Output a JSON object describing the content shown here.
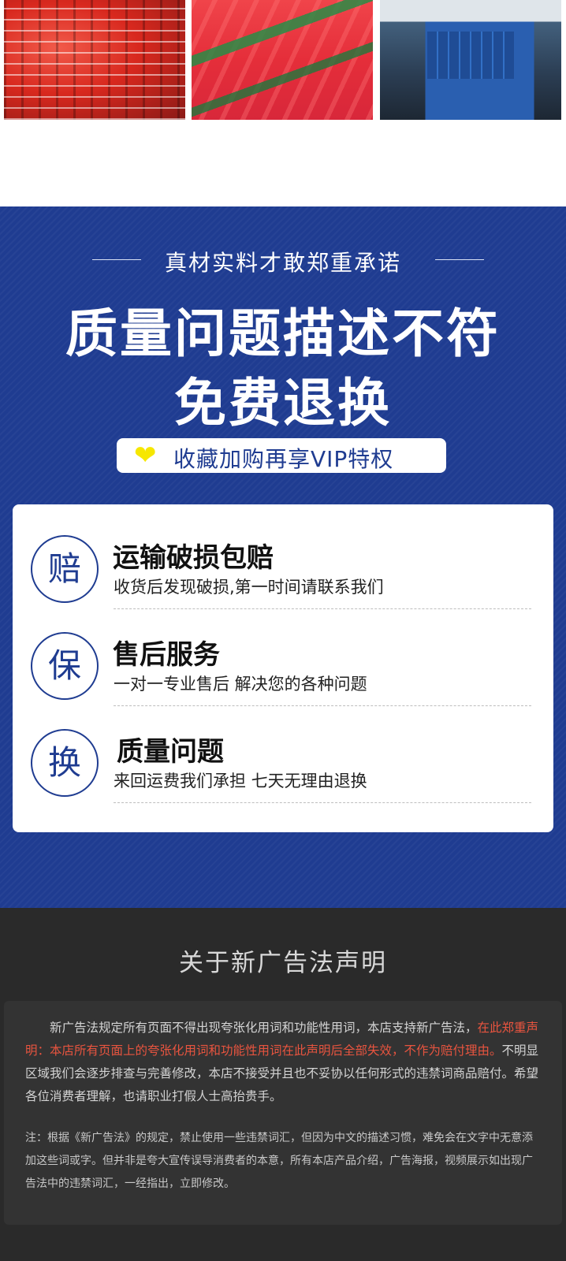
{
  "photos": [
    {
      "alt": "red lifebuoys stack"
    },
    {
      "alt": "red life jackets"
    },
    {
      "alt": "factory machinery"
    }
  ],
  "promise": {
    "subtitle": "真材实料才敢郑重承诺",
    "headline_line1": "质量问题描述不符",
    "headline_line2": "免费退换",
    "vip_icon": "heart-icon",
    "vip_text": "收藏加购再享VIP特权",
    "accent_color": "#1f3c91",
    "heart_color": "#f6e700"
  },
  "services": [
    {
      "badge": "赔",
      "title": "运输破损包赔",
      "desc": "收货后发现破损,第一时间请联系我们"
    },
    {
      "badge": "保",
      "title": "售后服务",
      "desc": "一对一专业售后 解决您的各种问题"
    },
    {
      "badge": "换",
      "title": "质量问题",
      "desc": "来回运费我们承担 七天无理由退换"
    }
  ],
  "legal": {
    "title": "关于新广告法声明",
    "p1_before": "新广告法规定所有页面不得出现夸张化用词和功能性用词，本店支持新广告法，",
    "p1_highlight": "在此郑重声明：本店所有页面上的夸张化用词和功能性用词在此声明后全部失效，不作为赔付理由。",
    "p1_after": "不明显区域我们会逐步排查与完善修改，本店不接受并且也不妥协以任何形式的违禁词商品赔付。希望各位消费者理解，也请职业打假人士高抬贵手。",
    "p2": "注：根据《新广告法》的规定，禁止使用一些违禁词汇，但因为中文的描述习惯，难免会在文字中无意添加这些词或字。但并非是夸大宣传误导消费者的本意，所有本店产品介绍，广告海报，视频展示如出现广告法中的违禁词汇，一经指出，立即修改。",
    "highlight_color": "#e8543f"
  }
}
